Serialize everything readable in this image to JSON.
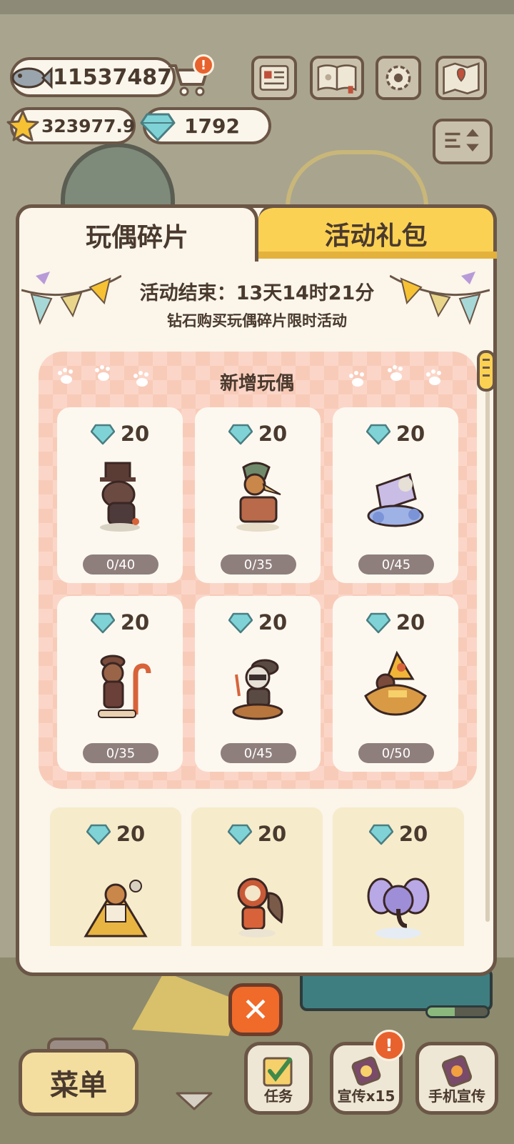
{
  "hud": {
    "fish_coins": "11537487",
    "stars": "323977.9",
    "gems": "1792",
    "cart_alert": "!"
  },
  "tabs": [
    {
      "label": "玩偶碎片",
      "active": true
    },
    {
      "label": "活动礼包",
      "active": false
    }
  ],
  "event": {
    "countdown": "活动结束：13天14时21分",
    "description": "钻石购买玩偶碎片限时活动"
  },
  "featured": {
    "title": "新增玩偶",
    "items": [
      {
        "price": "20",
        "progress": "0/40",
        "icon": "doll-top-hat-dog"
      },
      {
        "price": "20",
        "progress": "0/35",
        "icon": "doll-bird-mask"
      },
      {
        "price": "20",
        "progress": "0/45",
        "icon": "doll-lace-pillow"
      },
      {
        "price": "20",
        "progress": "0/35",
        "icon": "doll-candy-cane"
      },
      {
        "price": "20",
        "progress": "0/45",
        "icon": "doll-raccoon-pirate"
      },
      {
        "price": "20",
        "progress": "0/50",
        "icon": "doll-witch-hat"
      }
    ]
  },
  "more_items": [
    {
      "price": "20",
      "icon": "doll-pharaoh-cat"
    },
    {
      "price": "20",
      "icon": "doll-flower-squirrel"
    },
    {
      "price": "20",
      "icon": "doll-purple-elephant"
    }
  ],
  "close_label": "✕",
  "bottom": {
    "menu": "菜单",
    "tasks": "任务",
    "promo": "宣传x15",
    "phone_promo": "手机宣传",
    "promo_alert": "!"
  },
  "colors": {
    "accent_yellow": "#fbd154",
    "outline_brown": "#6b5646",
    "close_orange": "#f06a2a",
    "gem_cyan": "#7fd3d6"
  }
}
